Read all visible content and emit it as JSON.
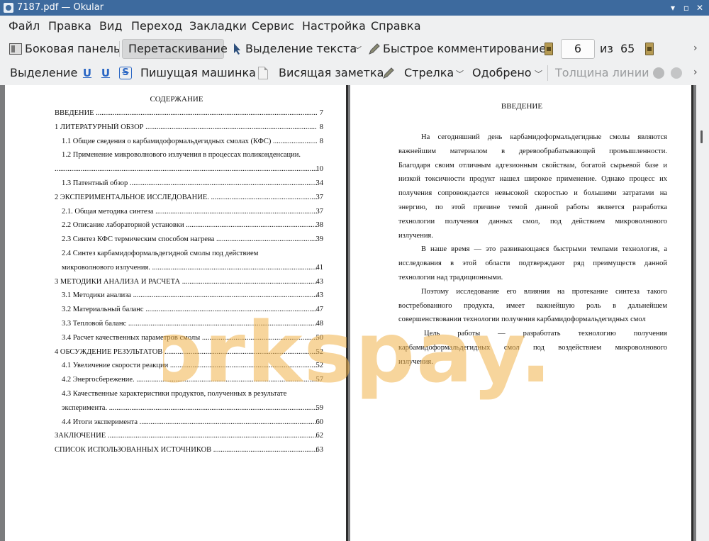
{
  "window": {
    "title": "7187.pdf  — Okular"
  },
  "menu": {
    "items": [
      "Файл",
      "Правка",
      "Вид",
      "Переход",
      "Закладки",
      "Сервис",
      "Настройка",
      "Справка"
    ]
  },
  "toolbar1": {
    "sidebar_label": "Боковая панель",
    "drag_label": "Перетаскивание",
    "text_select_label": "Выделение текста",
    "quick_annot_label": "Быстрое комментирование",
    "page_current": "6",
    "page_of": "из",
    "page_total": "65"
  },
  "toolbar2": {
    "highlight_label": "Выделение",
    "typewriter_label": "Пишущая машинка",
    "popup_note_label": "Висящая заметка",
    "arrow_label": "Стрелка",
    "stamp_label": "Одобрено",
    "line_width_label": "Толщина линии"
  },
  "left_page": {
    "title": "СОДЕРЖАНИЕ",
    "entries": [
      {
        "text": "ВВЕДЕНИЕ",
        "page": "7"
      },
      {
        "text": "1 ЛИТЕРАТУРНЫЙ ОБЗОР",
        "page": "8"
      },
      {
        "text": "1.1 Общие сведения о карбамидоформальдегидных смолах (КФС)",
        "page": "8"
      },
      {
        "text": "1.2 Применение микроволнового излучения в процессах поликонденсации.",
        "page": ""
      },
      {
        "text": "",
        "page": "10"
      },
      {
        "text": "1.3 Патентный обзор",
        "page": "34"
      },
      {
        "text": "2 ЭКСПЕРИМЕНТАЛЬНОЕ ИССЛЕДОВАНИЕ.",
        "page": "37"
      },
      {
        "text": "2.1. Общая методика синтеза",
        "page": "37"
      },
      {
        "text": "2.2 Описание лабораторной установки",
        "page": "38"
      },
      {
        "text": "2.3 Синтез КФС термическим способом нагрева",
        "page": "39"
      },
      {
        "text": "2.4 Синтез карбамидоформальдегидной смолы под действием",
        "page": ""
      },
      {
        "text": "микроволнового излучения.",
        "page": "41"
      },
      {
        "text": "3 МЕТОДИКИ АНАЛИЗА И РАСЧЕТА",
        "page": "43"
      },
      {
        "text": "3.1 Методики анализа",
        "page": "43"
      },
      {
        "text": "3.2 Материальный баланс",
        "page": "47"
      },
      {
        "text": "3.3 Тепловой баланс",
        "page": "48"
      },
      {
        "text": "3.4 Расчет качественных параметров смолы",
        "page": "50"
      },
      {
        "text": "4 ОБСУЖДЕНИЕ РЕЗУЛЬТАТОВ",
        "page": "52"
      },
      {
        "text": "4.1 Увеличение скорости реакции",
        "page": "52"
      },
      {
        "text": "4.2 Энергосбережение.",
        "page": "57"
      },
      {
        "text": "4.3 Качественные характеристики продуктов, полученных в результате",
        "page": ""
      },
      {
        "text": "эксперимента.",
        "page": "59"
      },
      {
        "text": "4.4 Итоги эксперимента",
        "page": "60"
      },
      {
        "text": "ЗАКЛЮЧЕНИЕ",
        "page": "62"
      },
      {
        "text": "СПИСОК ИСПОЛЬЗОВАННЫХ ИСТОЧНИКОВ",
        "page": "63"
      }
    ]
  },
  "right_page": {
    "title": "ВВЕДЕНИЕ",
    "lines": [
      "На сегодняшний день карбамидоформальдегидные смолы являются",
      "важнейшим материалом в деревообрабатывающей промышленности.",
      "Благодаря своим отличным адгезионным свойствам, богатой сырьевой базе и",
      "низкой токсичности продукт нашел широкое применение. Однако процесс их",
      "получения сопровождается невысокой скоростью и большими затратами на",
      "энергию, по этой причине темой данной работы является разработка",
      "технологии получения данных смол, под действием микроволнового",
      "излучения.",
      "В наше время — это развивающаяся быстрыми темпами технология, а",
      "исследования в этой области подтверждают ряд преимуществ данной",
      "технологии над традиционными.",
      "Поэтому исследование его влияния на протекание синтеза такого",
      "востребованного продукта, имеет важнейшую роль в дальнейшем",
      "совершенствовании технологии получения карбамидоформальдегидных смол",
      "Цель работы — разработать технологию получения",
      "карбамидоформальдегидных смол под воздействием микроволнового",
      "излучения."
    ]
  },
  "watermark": {
    "text": "workspay.ru"
  },
  "colors": {
    "titlebar": "#3d6a9e",
    "watermark": "#f0b24a"
  }
}
